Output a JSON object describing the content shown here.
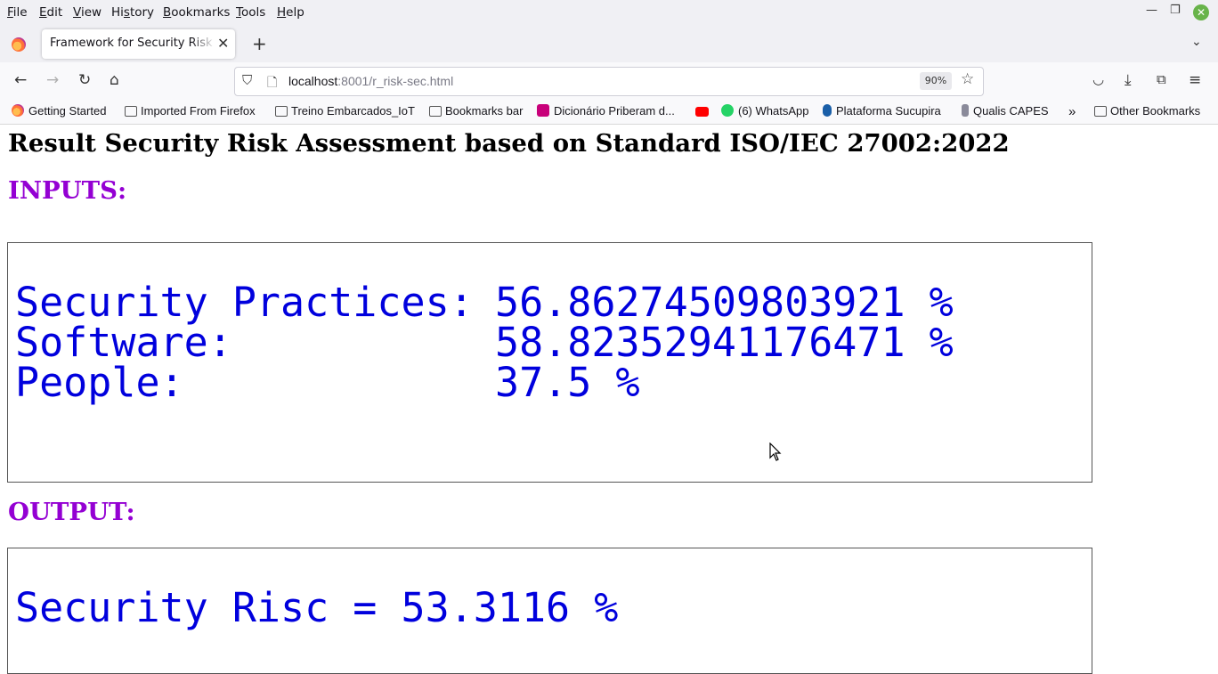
{
  "menubar": {
    "items": [
      "File",
      "Edit",
      "View",
      "History",
      "Bookmarks",
      "Tools",
      "Help"
    ],
    "underline": [
      "F",
      "E",
      "V",
      "s",
      "B",
      "T",
      "H"
    ]
  },
  "tab": {
    "title": "Framework for Security Risk Assessment",
    "close": "✕"
  },
  "navbar": {
    "url_host": "localhost",
    "url_rest": ":8001/r_risk-sec.html",
    "zoom": "90%"
  },
  "bookmarks": [
    {
      "label": "Getting Started",
      "icon": "firefox-icon"
    },
    {
      "label": "Imported From Firefox",
      "icon": "folder-icon"
    },
    {
      "label": "Treino Embarcados_IoT",
      "icon": "folder-icon"
    },
    {
      "label": "Bookmarks bar",
      "icon": "folder-icon"
    },
    {
      "label": "Dicionário Priberam d...",
      "icon": "priberam-icon"
    },
    {
      "label": "",
      "icon": "youtube-icon"
    },
    {
      "label": "(6) WhatsApp",
      "icon": "whatsapp-icon"
    },
    {
      "label": "Plataforma Sucupira",
      "icon": "sucupira-icon"
    },
    {
      "label": "Qualis CAPES",
      "icon": "capes-icon"
    },
    {
      "label": "Other Bookmarks",
      "icon": "folder-icon"
    }
  ],
  "page": {
    "title": "Result Security Risk Assessment based on Standard ISO/IEC 27002:2022",
    "inputs_heading": "INPUTS:",
    "inputs": {
      "practices_label": "Security Practices:",
      "practices_value": "56.86274509803921 %",
      "software_label": "Software:",
      "software_value": "58.82352941176471 %",
      "people_label": "People:",
      "people_value": "37.5 %"
    },
    "output_heading": "OUTPUT:",
    "output": {
      "text": "Security Risc = 53.3116 %"
    }
  },
  "colors": {
    "heading_purple": "#9400d3",
    "value_blue": "#0000dd"
  }
}
